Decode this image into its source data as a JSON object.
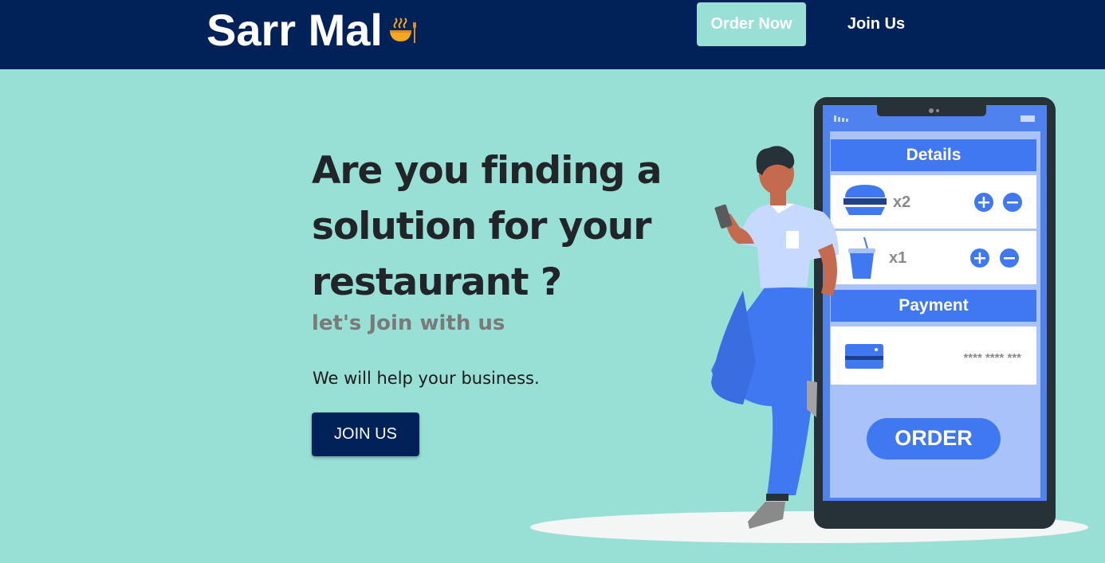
{
  "header": {
    "brand": "Sarr Mal",
    "brand_icon": "food-bowl-icon",
    "order_button": "Order Now",
    "join_link": "Join Us"
  },
  "hero": {
    "title": "Are you finding a solution for your restaurant ?",
    "subtitle": "let's Join with us",
    "text": "We will help your business.",
    "cta": "JOIN US"
  },
  "phone": {
    "details_label": "Details",
    "item1_qty": "x2",
    "item2_qty": "x1",
    "payment_label": "Payment",
    "card_number": "**** **** ***",
    "order_label": "ORDER"
  },
  "colors": {
    "navbar": "#002259",
    "background": "#98e0d6",
    "accent_blue": "#4078f2"
  }
}
